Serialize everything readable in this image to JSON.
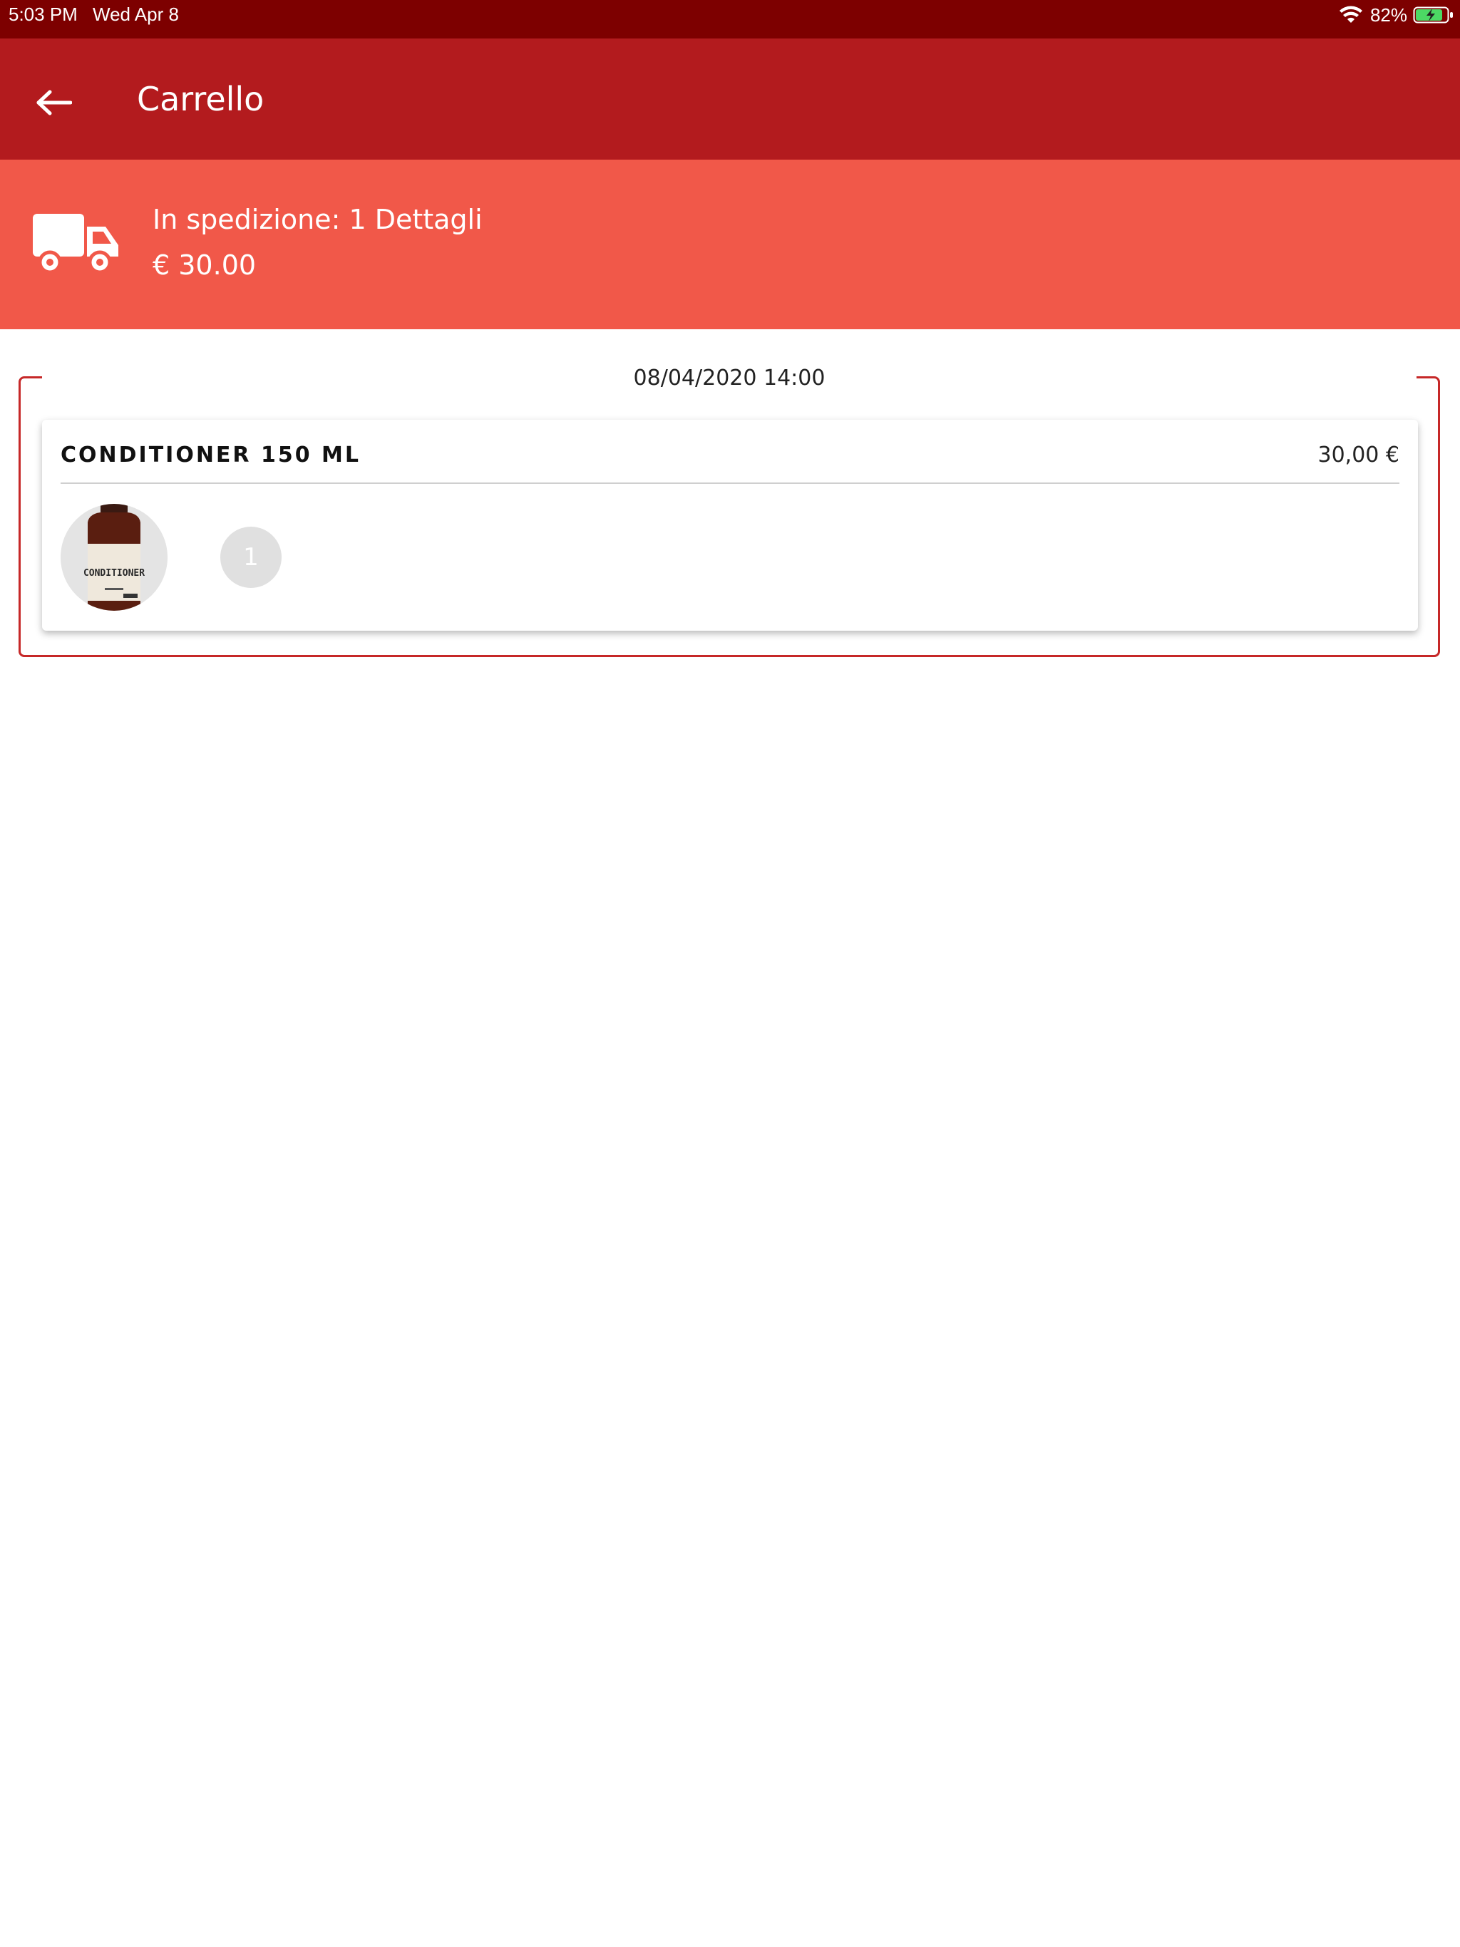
{
  "status_bar": {
    "time": "5:03 PM",
    "date": "Wed Apr 8",
    "battery_percent": "82%",
    "icons": [
      "wifi-icon",
      "battery-charging-icon"
    ]
  },
  "app_bar": {
    "back_icon": "arrow-left-icon",
    "title": "Carrello"
  },
  "shipping": {
    "icon": "truck-icon",
    "label": "In spedizione: 1 Dettagli",
    "amount": "€ 30.00"
  },
  "order": {
    "date": "08/04/2020 14:00",
    "items": [
      {
        "name": "CONDITIONER 150 ML",
        "price": "30,00 €",
        "quantity": "1",
        "image_label": "CONDITIONER"
      }
    ]
  },
  "colors": {
    "status_bar": "#7d0000",
    "app_bar": "#b31b1e",
    "banner": "#f15849",
    "group_border": "#c62828"
  }
}
